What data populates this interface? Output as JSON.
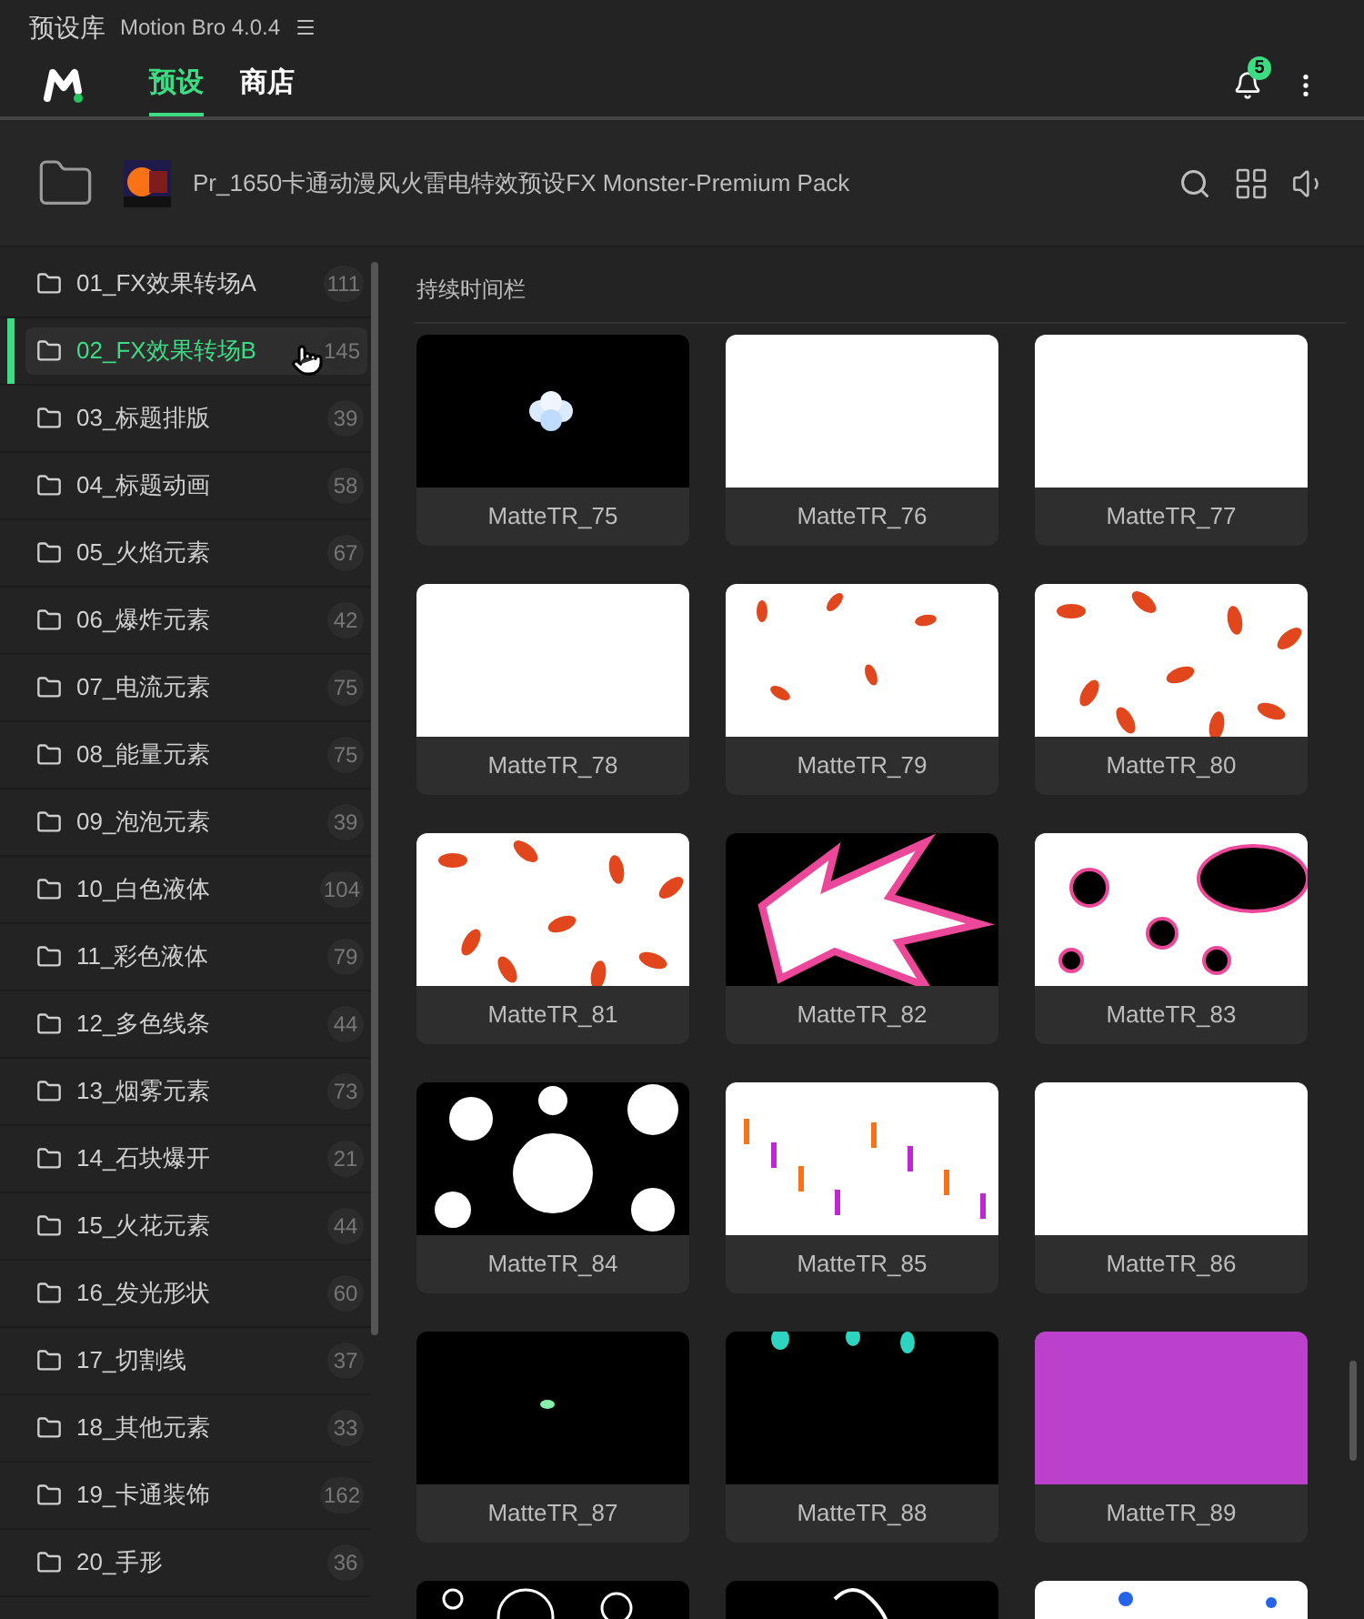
{
  "title_bar": {
    "title": "预设库",
    "app": "Motion Bro 4.0.4"
  },
  "tabs": [
    {
      "label": "预设",
      "selected": true
    },
    {
      "label": "商店",
      "selected": false
    }
  ],
  "notifications": {
    "count": "5"
  },
  "pack": {
    "title": "Pr_1650卡通动漫风火雷电特效预设FX Monster-Premium Pack"
  },
  "sidebar": {
    "items": [
      {
        "name": "01_FX效果转场A",
        "count": "111",
        "selected": false
      },
      {
        "name": "02_FX效果转场B",
        "count": "145",
        "selected": true
      },
      {
        "name": "03_标题排版",
        "count": "39",
        "selected": false
      },
      {
        "name": "04_标题动画",
        "count": "58",
        "selected": false
      },
      {
        "name": "05_火焰元素",
        "count": "67",
        "selected": false
      },
      {
        "name": "06_爆炸元素",
        "count": "42",
        "selected": false
      },
      {
        "name": "07_电流元素",
        "count": "75",
        "selected": false
      },
      {
        "name": "08_能量元素",
        "count": "75",
        "selected": false
      },
      {
        "name": "09_泡泡元素",
        "count": "39",
        "selected": false
      },
      {
        "name": "10_白色液体",
        "count": "104",
        "selected": false
      },
      {
        "name": "11_彩色液体",
        "count": "79",
        "selected": false
      },
      {
        "name": "12_多色线条",
        "count": "44",
        "selected": false
      },
      {
        "name": "13_烟雾元素",
        "count": "73",
        "selected": false
      },
      {
        "name": "14_石块爆开",
        "count": "21",
        "selected": false
      },
      {
        "name": "15_火花元素",
        "count": "44",
        "selected": false
      },
      {
        "name": "16_发光形状",
        "count": "60",
        "selected": false
      },
      {
        "name": "17_切割线",
        "count": "37",
        "selected": false
      },
      {
        "name": "18_其他元素",
        "count": "33",
        "selected": false
      },
      {
        "name": "19_卡通装饰",
        "count": "162",
        "selected": false
      },
      {
        "name": "20_手形",
        "count": "36",
        "selected": false
      }
    ]
  },
  "section": {
    "title": "持续时间栏"
  },
  "presets": [
    {
      "kind": "card",
      "label": "MatteTR_75"
    },
    {
      "kind": "card",
      "label": "MatteTR_76"
    },
    {
      "kind": "card",
      "label": "MatteTR_77"
    },
    {
      "kind": "card",
      "label": "MatteTR_78"
    },
    {
      "kind": "card",
      "label": "MatteTR_79"
    },
    {
      "kind": "card",
      "label": "MatteTR_80"
    },
    {
      "kind": "card",
      "label": "MatteTR_81"
    },
    {
      "kind": "card",
      "label": "MatteTR_82"
    },
    {
      "kind": "card",
      "label": "MatteTR_83"
    },
    {
      "kind": "card",
      "label": "MatteTR_84"
    },
    {
      "kind": "card",
      "label": "MatteTR_85"
    },
    {
      "kind": "card",
      "label": "MatteTR_86"
    },
    {
      "kind": "card",
      "label": "MatteTR_87"
    },
    {
      "kind": "card",
      "label": "MatteTR_88"
    },
    {
      "kind": "card",
      "label": "MatteTR_89"
    },
    {
      "kind": "picture"
    },
    {
      "kind": "picture"
    },
    {
      "kind": "picture"
    }
  ]
}
